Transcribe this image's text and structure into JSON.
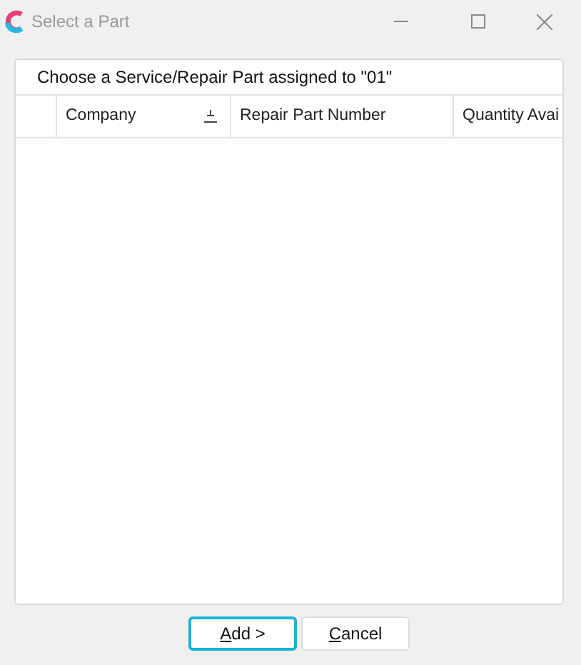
{
  "window": {
    "title": "Select a Part"
  },
  "panel": {
    "caption": "Choose a Service/Repair Part assigned to \"01\""
  },
  "table": {
    "columns": [
      {
        "label": "Company",
        "sorted": true
      },
      {
        "label": "Repair Part Number",
        "sorted": false
      },
      {
        "label": "Quantity Avai",
        "sorted": false
      }
    ]
  },
  "buttons": [
    {
      "label": "Add >",
      "default": true
    },
    {
      "label": "Cancel",
      "default": false
    }
  ]
}
